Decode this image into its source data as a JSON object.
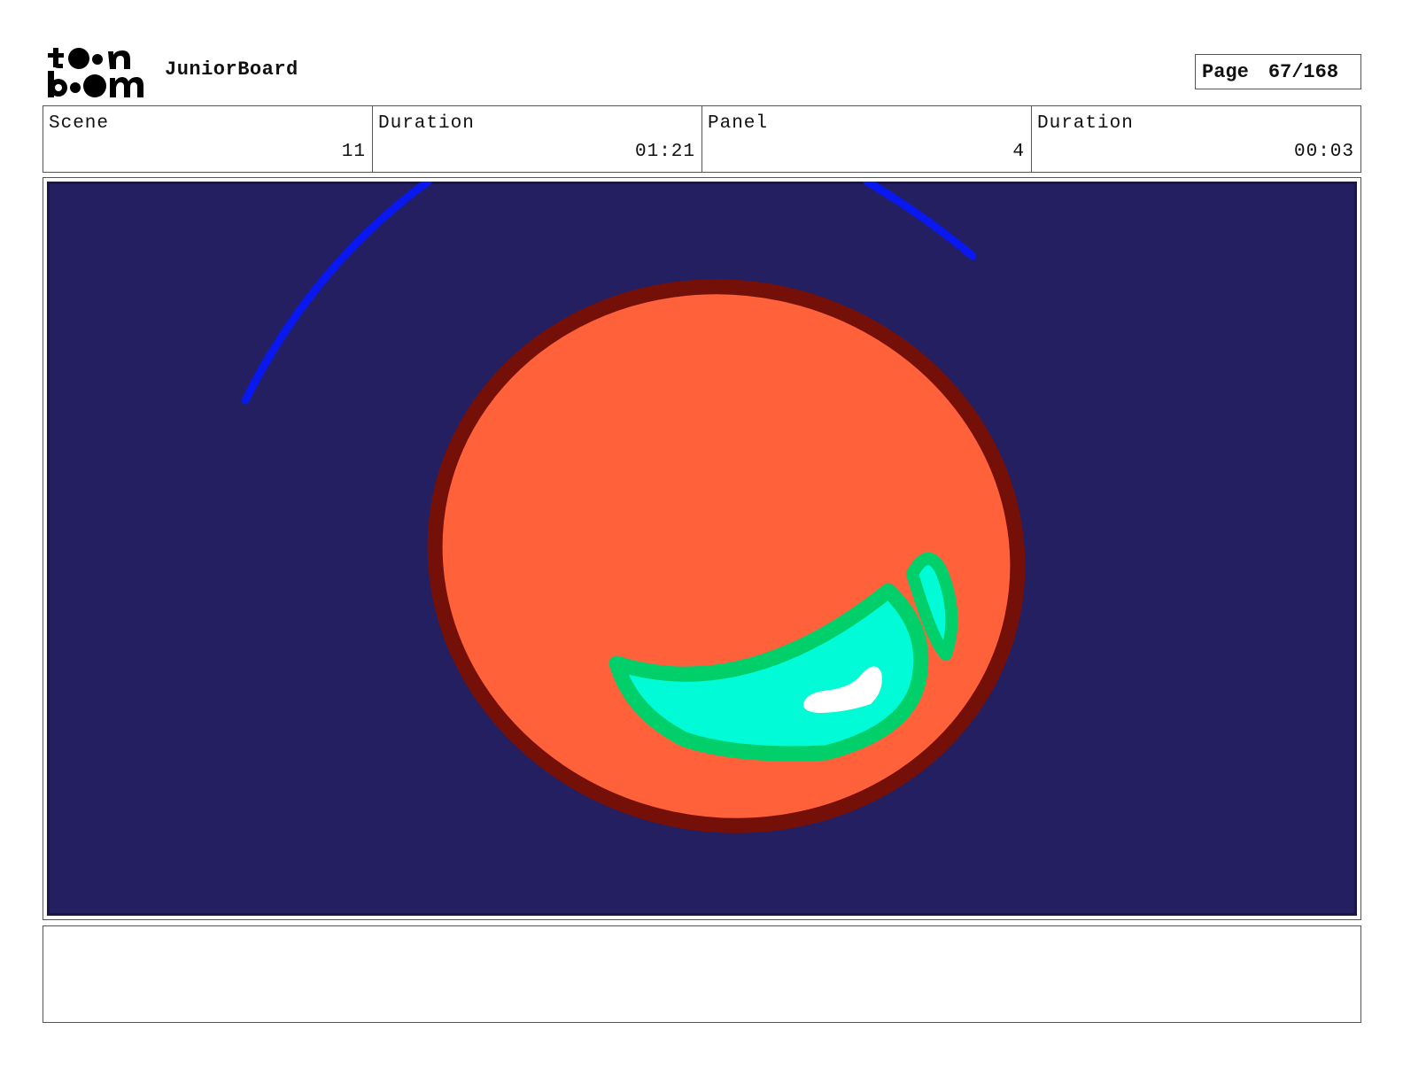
{
  "header": {
    "logo_text": "toon boom",
    "app_title": "JuniorBoard",
    "page_label": "Page",
    "page_number": "67/168"
  },
  "info": {
    "scene_label": "Scene",
    "scene_value": "11",
    "scene_duration_label": "Duration",
    "scene_duration_value": "01:21",
    "panel_label": "Panel",
    "panel_value": "4",
    "panel_duration_label": "Duration",
    "panel_duration_value": "00:03"
  },
  "caption": {
    "text": ""
  },
  "colors": {
    "background": "#241f61",
    "arc": "#0a18f0",
    "ball_fill": "#ff623b",
    "ball_outline": "#751008",
    "smile_outline": "#00cf6a",
    "smile_fill": "#00fbd6",
    "highlight": "#ffffff"
  }
}
